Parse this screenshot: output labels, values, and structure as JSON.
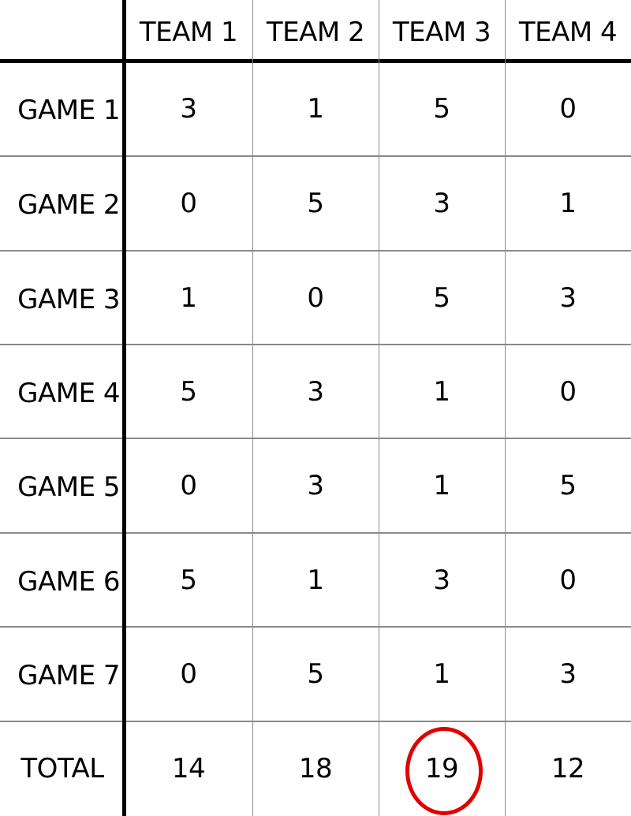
{
  "chart_data": {
    "type": "table",
    "title": "",
    "columns": [
      "TEAM 1",
      "TEAM 2",
      "TEAM 3",
      "TEAM 4"
    ],
    "rows": [
      {
        "label": "GAME 1",
        "values": [
          3,
          1,
          5,
          0
        ]
      },
      {
        "label": "GAME 2",
        "values": [
          0,
          5,
          3,
          1
        ]
      },
      {
        "label": "GAME 3",
        "values": [
          1,
          0,
          5,
          3
        ]
      },
      {
        "label": "GAME 4",
        "values": [
          5,
          3,
          1,
          0
        ]
      },
      {
        "label": "GAME 5",
        "values": [
          0,
          3,
          1,
          5
        ]
      },
      {
        "label": "GAME 6",
        "values": [
          5,
          1,
          3,
          0
        ]
      },
      {
        "label": "GAME 7",
        "values": [
          0,
          5,
          1,
          3
        ]
      }
    ],
    "total": {
      "label": "TOTAL",
      "values": [
        14,
        18,
        19,
        12
      ]
    },
    "highlight": {
      "row": "TOTAL",
      "column": "TEAM 3",
      "value": 19,
      "color": "#e00000",
      "shape": "circle"
    }
  }
}
